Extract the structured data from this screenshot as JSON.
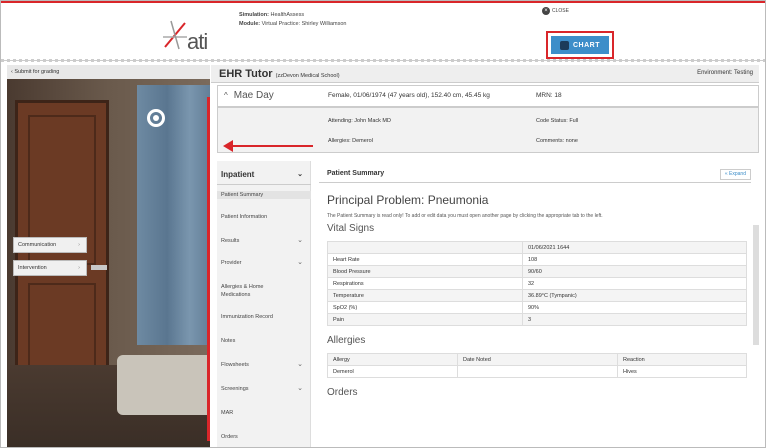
{
  "header": {
    "logo_text": "ati",
    "simulation_label": "Simulation:",
    "simulation_value": "HealthAssess",
    "module_label": "Module:",
    "module_value": "Virtual Practice: Shirley Williamson",
    "close_label": "CLOSE",
    "chart_label": "CHART",
    "accent_color": "#d9262a",
    "chart_button_color": "#3d8ec9"
  },
  "scene": {
    "submit_label": "Submit for grading",
    "communication_label": "Communication",
    "intervention_label": "Intervention"
  },
  "ehr": {
    "title": "EHR Tutor",
    "subtitle": "(zzDevon Medical School)",
    "environment": "Environment: Testing",
    "patient": {
      "name": "Mae Day",
      "demographics": "Female, 01/06/1974 (47 years old), 152.40 cm, 45.45 kg",
      "mrn": "MRN: 18",
      "attending": "Attending: John Mack MD",
      "code_status": "Code Status: Full",
      "allergies": "Allergies: Demerol",
      "comments": "Comments: none"
    },
    "nav": {
      "header": "Inpatient",
      "items": [
        {
          "label": "Patient Summary",
          "expandable": false
        },
        {
          "label": "Patient Information",
          "expandable": false
        },
        {
          "label": "Results",
          "expandable": true
        },
        {
          "label": "Provider",
          "expandable": true
        },
        {
          "label": "Allergies & Home Medications",
          "expandable": false
        },
        {
          "label": "Immunization Record",
          "expandable": false
        },
        {
          "label": "Notes",
          "expandable": false
        },
        {
          "label": "Flowsheets",
          "expandable": true
        },
        {
          "label": "Screenings",
          "expandable": true
        },
        {
          "label": "MAR",
          "expandable": false
        },
        {
          "label": "Orders",
          "expandable": false
        }
      ]
    },
    "summary": {
      "header": "Patient Summary",
      "expand_label": "« Expand",
      "principal_problem": "Principal Problem: Pneumonia",
      "readonly_note": "The Patient Summary is read only! To add or edit data you must open another page by clicking the appropriate tab to the left.",
      "vitals_title": "Vital Signs",
      "vitals_datetime": "01/06/2021 1644",
      "vitals": [
        {
          "label": "Heart Rate",
          "value": "108"
        },
        {
          "label": "Blood Pressure",
          "value": "90/60"
        },
        {
          "label": "Respirations",
          "value": "32"
        },
        {
          "label": "Temperature",
          "value": "36.89°C (Tympanic)"
        },
        {
          "label": "SpO2 (%)",
          "value": "90%"
        },
        {
          "label": "Pain",
          "value": "3"
        }
      ],
      "allergies_title": "Allergies",
      "allergy_headers": [
        "Allergy",
        "Date Noted",
        "Reaction"
      ],
      "allergy_rows": [
        {
          "allergy": "Demerol",
          "date": "",
          "reaction": "Hives"
        }
      ],
      "orders_title": "Orders"
    }
  }
}
